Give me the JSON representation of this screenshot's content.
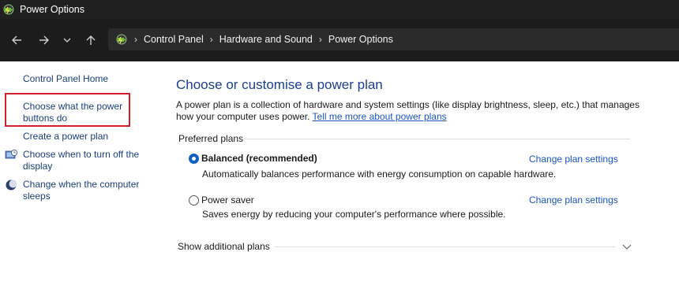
{
  "window": {
    "title": "Power Options",
    "app_icon": "power-options-icon"
  },
  "nav": {
    "back_icon": "arrow-left-icon",
    "forward_icon": "arrow-right-icon",
    "recent_icon": "chevron-down-icon",
    "up_icon": "arrow-up-icon"
  },
  "breadcrumb": [
    "Control Panel",
    "Hardware and Sound",
    "Power Options"
  ],
  "sidebar": {
    "home": "Control Panel Home",
    "items": [
      {
        "line1": "Choose what the power",
        "line2": "buttons do",
        "highlighted": true
      },
      {
        "line1": "Create a power plan",
        "line2": ""
      },
      {
        "line1": "Choose when to turn off the",
        "line2": "display",
        "icon": "display-clock-icon"
      },
      {
        "line1": "Change when the computer",
        "line2": "sleeps",
        "icon": "moon-icon"
      }
    ]
  },
  "main": {
    "title": "Choose or customise a power plan",
    "intro": "A power plan is a collection of hardware and system settings (like display brightness, sleep, etc.) that manages how your computer uses power.",
    "intro_link": "Tell me more about power plans",
    "preferred_label": "Preferred plans",
    "plans": [
      {
        "name": "Balanced (recommended)",
        "selected": true,
        "description": "Automatically balances performance with energy consumption on capable hardware.",
        "action": "Change plan settings"
      },
      {
        "name": "Power saver",
        "selected": false,
        "description": "Saves energy by reducing your computer's performance where possible.",
        "action": "Change plan settings"
      }
    ],
    "more_plans": "Show additional plans"
  },
  "colors": {
    "titlebar_bg": "#202020",
    "navbar_bg": "#1c1c1c",
    "title_blue": "#1b3f8c",
    "link_blue": "#1a54c4",
    "highlight_red": "#d11f2c"
  }
}
